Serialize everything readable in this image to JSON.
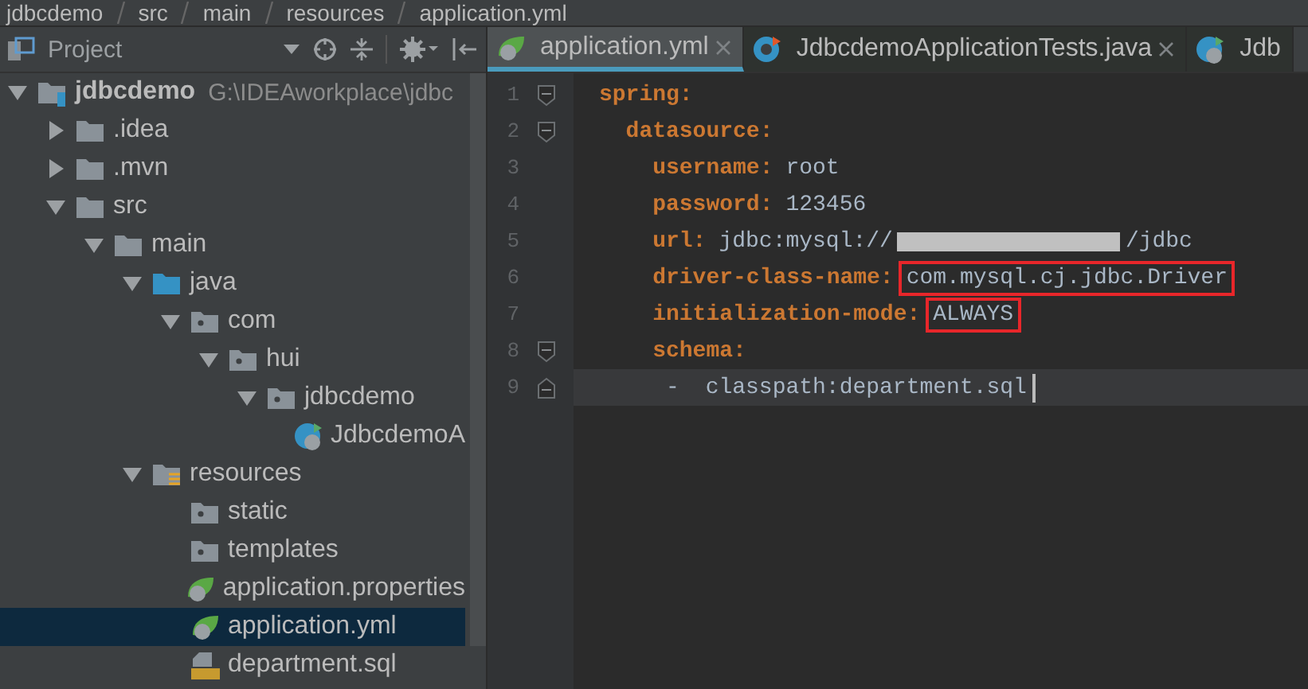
{
  "breadcrumb": [
    "jdbcdemo",
    "src",
    "main",
    "resources",
    "application.yml"
  ],
  "project_panel": {
    "title": "Project"
  },
  "tree": [
    {
      "label": "jdbcdemo",
      "path": "G:\\IDEAworkplace\\jdbc",
      "kind": "module",
      "expanded": true,
      "selected": false,
      "children": [
        {
          "label": ".idea",
          "kind": "folder",
          "expanded": false,
          "selected": false
        },
        {
          "label": ".mvn",
          "kind": "folder",
          "expanded": false,
          "selected": false
        },
        {
          "label": "src",
          "kind": "folder",
          "expanded": true,
          "selected": false,
          "children": [
            {
              "label": "main",
              "kind": "folder",
              "expanded": true,
              "selected": false,
              "children": [
                {
                  "label": "java",
                  "kind": "source-folder",
                  "expanded": true,
                  "selected": false,
                  "children": [
                    {
                      "label": "com",
                      "kind": "package",
                      "expanded": true,
                      "selected": false,
                      "children": [
                        {
                          "label": "hui",
                          "kind": "package",
                          "expanded": true,
                          "selected": false,
                          "children": [
                            {
                              "label": "jdbcdemo",
                              "kind": "package",
                              "expanded": true,
                              "selected": false,
                              "children": [
                                {
                                  "label": "JdbcdemoA",
                                  "kind": "spring-class",
                                  "selected": false
                                }
                              ]
                            }
                          ]
                        }
                      ]
                    }
                  ]
                },
                {
                  "label": "resources",
                  "kind": "resources-folder",
                  "expanded": true,
                  "selected": false,
                  "children": [
                    {
                      "label": "static",
                      "kind": "package",
                      "selected": false
                    },
                    {
                      "label": "templates",
                      "kind": "package",
                      "selected": false
                    },
                    {
                      "label": "application.properties",
                      "kind": "spring-file",
                      "selected": false
                    },
                    {
                      "label": "application.yml",
                      "kind": "spring-file",
                      "selected": true
                    },
                    {
                      "label": "department.sql",
                      "kind": "sql-file",
                      "selected": false
                    }
                  ]
                }
              ]
            }
          ]
        }
      ]
    }
  ],
  "tabs": [
    {
      "label": "application.yml",
      "kind": "spring-file",
      "selected": true,
      "closable": true
    },
    {
      "label": "JdbcdemoApplicationTests.java",
      "kind": "test-class",
      "selected": false,
      "closable": true
    },
    {
      "label": "Jdb",
      "kind": "spring-class",
      "selected": false,
      "closable": false
    }
  ],
  "code_lines": [
    {
      "number": "1",
      "kind": "key",
      "key": "spring:",
      "fold_start": true,
      "fold_end": false,
      "current": false
    },
    {
      "number": "2",
      "kind": "key",
      "key": "  datasource:",
      "fold_start": true,
      "fold_end": false,
      "current": false
    },
    {
      "number": "3",
      "kind": "key",
      "key": "    username:",
      "segments": [
        {
          "kind": "text",
          "text": "root"
        }
      ],
      "fold_start": false,
      "fold_end": false,
      "current": false
    },
    {
      "number": "4",
      "kind": "key",
      "key": "    password:",
      "segments": [
        {
          "kind": "text",
          "text": "123456"
        }
      ],
      "fold_start": false,
      "fold_end": false,
      "current": false
    },
    {
      "number": "5",
      "kind": "key",
      "key": "    url:",
      "segments": [
        {
          "kind": "text",
          "text": "jdbc:mysql://"
        },
        {
          "kind": "redacted"
        },
        {
          "kind": "text",
          "text": "/jdbc"
        }
      ],
      "fold_start": false,
      "fold_end": false,
      "current": false
    },
    {
      "number": "6",
      "kind": "key",
      "key": "    driver-class-name:",
      "segments": [
        {
          "kind": "highlight",
          "text": "com.mysql.cj.jdbc.Driver"
        }
      ],
      "fold_start": false,
      "fold_end": false,
      "current": false
    },
    {
      "number": "7",
      "kind": "key",
      "key": "    initialization-mode:",
      "segments": [
        {
          "kind": "highlight",
          "text": "ALWAYS"
        }
      ],
      "fold_start": false,
      "fold_end": false,
      "current": false
    },
    {
      "number": "8",
      "kind": "key",
      "key": "    schema:",
      "fold_start": true,
      "fold_end": false,
      "current": false
    },
    {
      "number": "9",
      "kind": "item",
      "key": "     - ",
      "segments": [
        {
          "kind": "text",
          "text": "classpath:department.sql"
        },
        {
          "kind": "cursor"
        }
      ],
      "fold_start": false,
      "fold_end": true,
      "current": true
    }
  ]
}
